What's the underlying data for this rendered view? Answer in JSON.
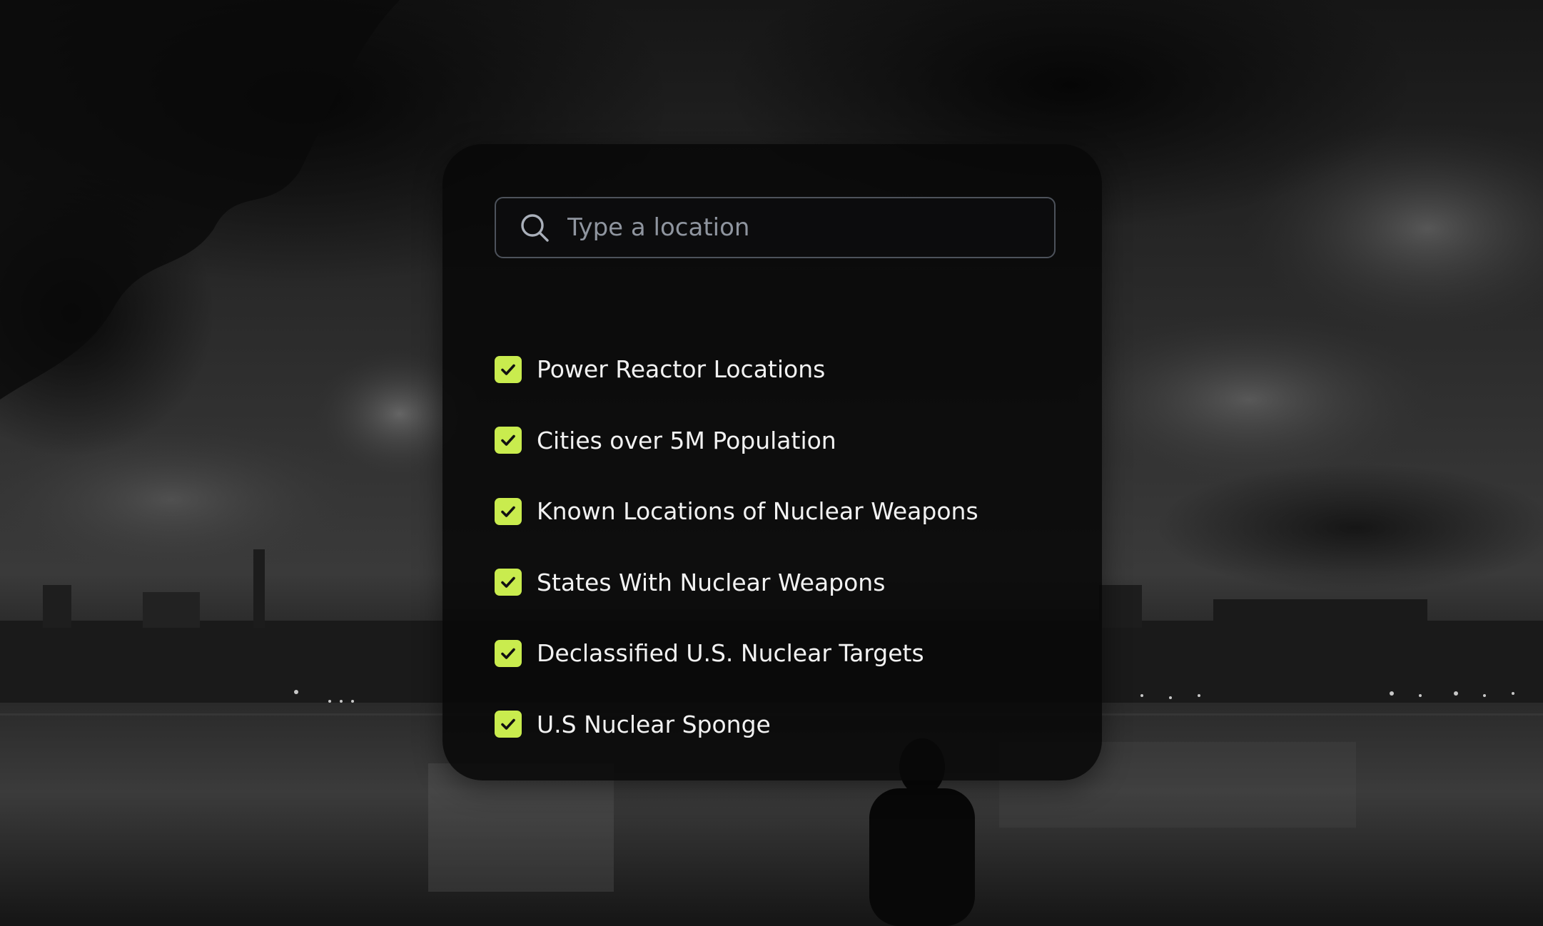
{
  "search": {
    "placeholder": "Type a location",
    "value": ""
  },
  "icons": {
    "search": "search-icon",
    "check": "check-icon"
  },
  "colors": {
    "accent": "#c9ec4e",
    "panel": "#080808",
    "text": "#f2f2f2",
    "placeholder": "#8f959f",
    "border": "#4d525b"
  },
  "layers": [
    {
      "label": "Power Reactor Locations",
      "checked": true
    },
    {
      "label": "Cities over 5M Population",
      "checked": true
    },
    {
      "label": "Known Locations of Nuclear Weapons",
      "checked": true
    },
    {
      "label": "States With Nuclear Weapons",
      "checked": true
    },
    {
      "label": "Declassified U.S. Nuclear Targets",
      "checked": true
    },
    {
      "label": "U.S Nuclear Sponge",
      "checked": true
    }
  ]
}
